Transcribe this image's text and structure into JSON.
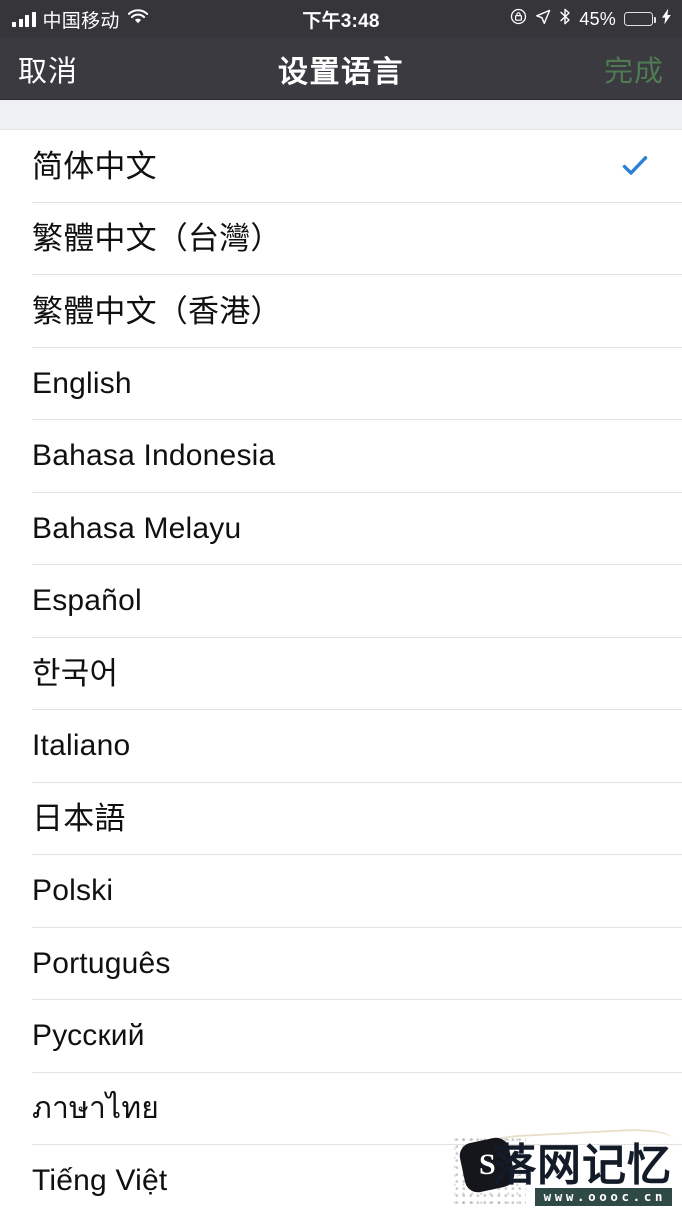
{
  "status_bar": {
    "carrier": "中国移动",
    "signal_icon": "signal-bars-icon",
    "wifi_icon": "wifi-icon",
    "time": "下午3:48",
    "rotation_lock_icon": "rotation-lock-icon",
    "location_icon": "location-arrow-icon",
    "bluetooth_icon": "bluetooth-icon",
    "battery_percent": "45%",
    "battery_level": 45,
    "charging_icon": "charging-bolt-icon",
    "background_color": "#35353a",
    "battery_fill_color": "#4cd25f"
  },
  "nav_bar": {
    "cancel_label": "取消",
    "title": "设置语言",
    "done_label": "完成",
    "background_color": "#3a3a40",
    "done_color": "#4f7a52",
    "title_color": "#ffffff"
  },
  "list": {
    "selected_index": 0,
    "check_color": "#2d7fd3",
    "separator_color": "#e2e2e4",
    "items": [
      {
        "label": "简体中文",
        "cjk": true,
        "selected": true
      },
      {
        "label": "繁體中文（台灣）",
        "cjk": true,
        "selected": false
      },
      {
        "label": "繁體中文（香港）",
        "cjk": true,
        "selected": false
      },
      {
        "label": "English",
        "cjk": false,
        "selected": false
      },
      {
        "label": "Bahasa Indonesia",
        "cjk": false,
        "selected": false
      },
      {
        "label": "Bahasa Melayu",
        "cjk": false,
        "selected": false
      },
      {
        "label": "Español",
        "cjk": false,
        "selected": false
      },
      {
        "label": "한국어",
        "cjk": true,
        "selected": false
      },
      {
        "label": "Italiano",
        "cjk": false,
        "selected": false
      },
      {
        "label": "日本語",
        "cjk": true,
        "selected": false
      },
      {
        "label": "Polski",
        "cjk": false,
        "selected": false
      },
      {
        "label": "Português",
        "cjk": false,
        "selected": false
      },
      {
        "label": "Русский",
        "cjk": false,
        "selected": false
      },
      {
        "label": "ภาษาไทย",
        "cjk": false,
        "selected": false
      },
      {
        "label": "Tiếng Việt",
        "cjk": false,
        "selected": false
      }
    ]
  },
  "watermark": {
    "logo_glyph": "S",
    "brand": "落网记忆",
    "url": "www.oooc.cn"
  }
}
